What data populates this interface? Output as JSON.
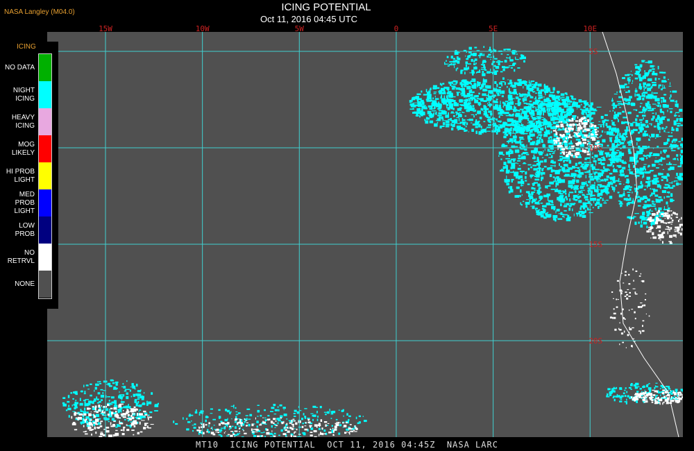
{
  "header": {
    "org": "NASA Langley (M04.0)",
    "title": "ICING POTENTIAL",
    "subtitle": "Oct 11, 2016 04:45 UTC"
  },
  "footer": {
    "text": "MT10  ICING POTENTIAL  OCT 11, 2016 04:45Z  NASA LARC"
  },
  "grid": {
    "longitudes": [
      {
        "label": "15W",
        "value": -15
      },
      {
        "label": "10W",
        "value": -10
      },
      {
        "label": "5W",
        "value": -5
      },
      {
        "label": "0",
        "value": 0
      },
      {
        "label": "5E",
        "value": 5
      },
      {
        "label": "10E",
        "value": 10
      }
    ],
    "latitudes": [
      {
        "label": "5S",
        "value": -5
      },
      {
        "label": "10S",
        "value": -10
      },
      {
        "label": "15S",
        "value": -15
      },
      {
        "label": "20S",
        "value": -20
      }
    ],
    "line_color": "#40d0d0",
    "label_color": "#cc2222"
  },
  "legend": {
    "title": "ICING",
    "items": [
      {
        "label": "NO DATA",
        "color": "#00b000"
      },
      {
        "label": "NIGHT\nICING",
        "color": "#00ffff"
      },
      {
        "label": "HEAVY\nICING",
        "color": "#e8a8e0"
      },
      {
        "label": "MOG\nLIKELY",
        "color": "#ff0000"
      },
      {
        "label": "HI PROB\nLIGHT",
        "color": "#ffff00"
      },
      {
        "label": "MED PROB\nLIGHT",
        "color": "#0000ff"
      },
      {
        "label": "LOW\nPROB",
        "color": "#000080"
      },
      {
        "label": "NO\nRETRVL",
        "color": "#ffffff"
      },
      {
        "label": "NONE",
        "color": "#505050"
      }
    ]
  }
}
